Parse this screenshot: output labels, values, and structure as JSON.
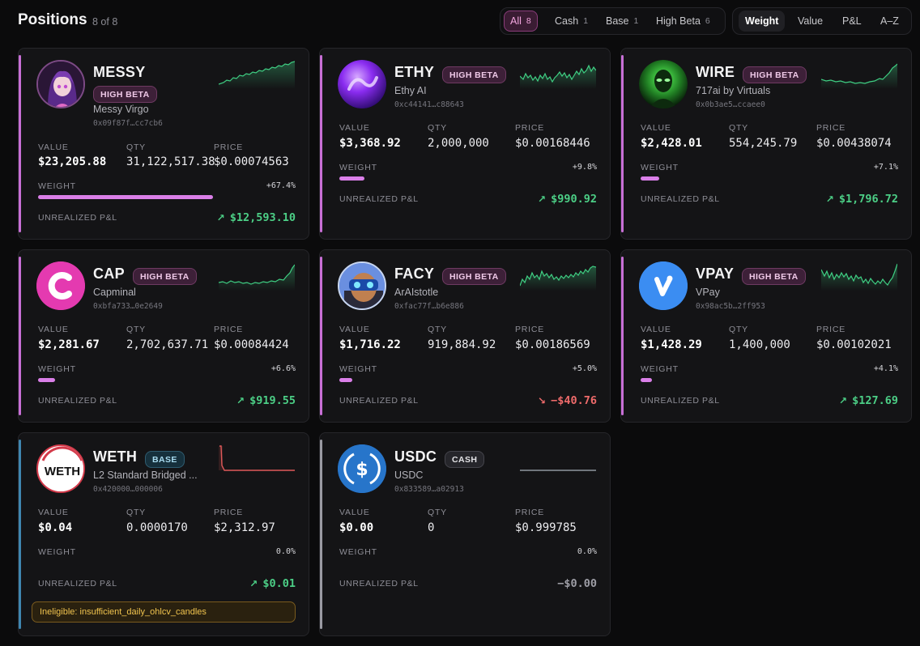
{
  "header": {
    "title": "Positions",
    "count": "8 of 8"
  },
  "filters": [
    {
      "label": "All",
      "count": "8"
    },
    {
      "label": "Cash",
      "count": "1"
    },
    {
      "label": "Base",
      "count": "1"
    },
    {
      "label": "High Beta",
      "count": "6"
    }
  ],
  "sort": [
    "Weight",
    "Value",
    "P&L",
    "A–Z"
  ],
  "labels": {
    "value": "VALUE",
    "qty": "QTY",
    "price": "PRICE",
    "weight": "WEIGHT",
    "pnl": "UNREALIZED P&L"
  },
  "colors": {
    "accent_high_beta": "#c86fd6",
    "accent_base": "#3f86b0",
    "accent_cash": "#9a9aa2",
    "positive": "#4ccf86",
    "negative": "#ef6b6b",
    "weight_bar": "#da7fe8"
  },
  "positions": [
    {
      "symbol": "MESSY",
      "badge": "HIGH BETA",
      "name": "Messy Virgo",
      "address": "0x09f87f…cc7cb6",
      "value": "$23,205.88",
      "qty": "31,122,517.38",
      "price": "$0.00074563",
      "weight": "+67.4%",
      "weight_fraction": 0.674,
      "pnl": "$12,593.10",
      "pnl_direction": "up",
      "avatar_icon": "anime-girl-avatar-icon"
    },
    {
      "symbol": "ETHY",
      "badge": "HIGH BETA",
      "name": "Ethy AI",
      "address": "0xc44141…c88643",
      "value": "$3,368.92",
      "qty": "2,000,000",
      "price": "$0.00168446",
      "weight": "+9.8%",
      "weight_fraction": 0.098,
      "pnl": "$990.92",
      "pnl_direction": "up",
      "avatar_icon": "purple-orb-avatar-icon"
    },
    {
      "symbol": "WIRE",
      "badge": "HIGH BETA",
      "name": "717ai by Virtuals",
      "address": "0x0b3ae5…ccaee0",
      "value": "$2,428.01",
      "qty": "554,245.79",
      "price": "$0.00438074",
      "weight": "+7.1%",
      "weight_fraction": 0.071,
      "pnl": "$1,796.72",
      "pnl_direction": "up",
      "avatar_icon": "green-alien-avatar-icon"
    },
    {
      "symbol": "CAP",
      "badge": "HIGH BETA",
      "name": "Capminal",
      "address": "0xbfa733…0e2649",
      "value": "$2,281.67",
      "qty": "2,702,637.71",
      "price": "$0.00084424",
      "weight": "+6.6%",
      "weight_fraction": 0.066,
      "pnl": "$919.55",
      "pnl_direction": "up",
      "avatar_icon": "pink-c-logo-icon"
    },
    {
      "symbol": "FACY",
      "badge": "HIGH BETA",
      "name": "ArAIstotle",
      "address": "0xfac77f…b6e886",
      "value": "$1,716.22",
      "qty": "919,884.92",
      "price": "$0.00186569",
      "weight": "+5.0%",
      "weight_fraction": 0.05,
      "pnl": "−$40.76",
      "pnl_direction": "down",
      "avatar_icon": "robot-face-avatar-icon"
    },
    {
      "symbol": "VPAY",
      "badge": "HIGH BETA",
      "name": "VPay",
      "address": "0x98ac5b…2ff953",
      "value": "$1,428.29",
      "qty": "1,400,000",
      "price": "$0.00102021",
      "weight": "+4.1%",
      "weight_fraction": 0.041,
      "pnl": "$127.69",
      "pnl_direction": "up",
      "avatar_icon": "blue-v-logo-icon"
    },
    {
      "symbol": "WETH",
      "badge": "BASE",
      "name": "L2 Standard Bridged ...",
      "address": "0x420000…000006",
      "value": "$0.04",
      "qty": "0.0000170",
      "price": "$2,312.97",
      "weight": "0.0%",
      "weight_fraction": 0,
      "pnl": "$0.01",
      "pnl_direction": "up",
      "avatar_icon": "weth-logo-icon",
      "warning": "Ineligible: insufficient_daily_ohlcv_candles"
    },
    {
      "symbol": "USDC",
      "badge": "CASH",
      "name": "USDC",
      "address": "0x833589…a02913",
      "value": "$0.00",
      "qty": "0",
      "price": "$0.999785",
      "weight": "0.0%",
      "weight_fraction": 0,
      "pnl": "−$0.00",
      "pnl_direction": "flat",
      "avatar_icon": "usdc-dollar-logo-icon"
    }
  ]
}
